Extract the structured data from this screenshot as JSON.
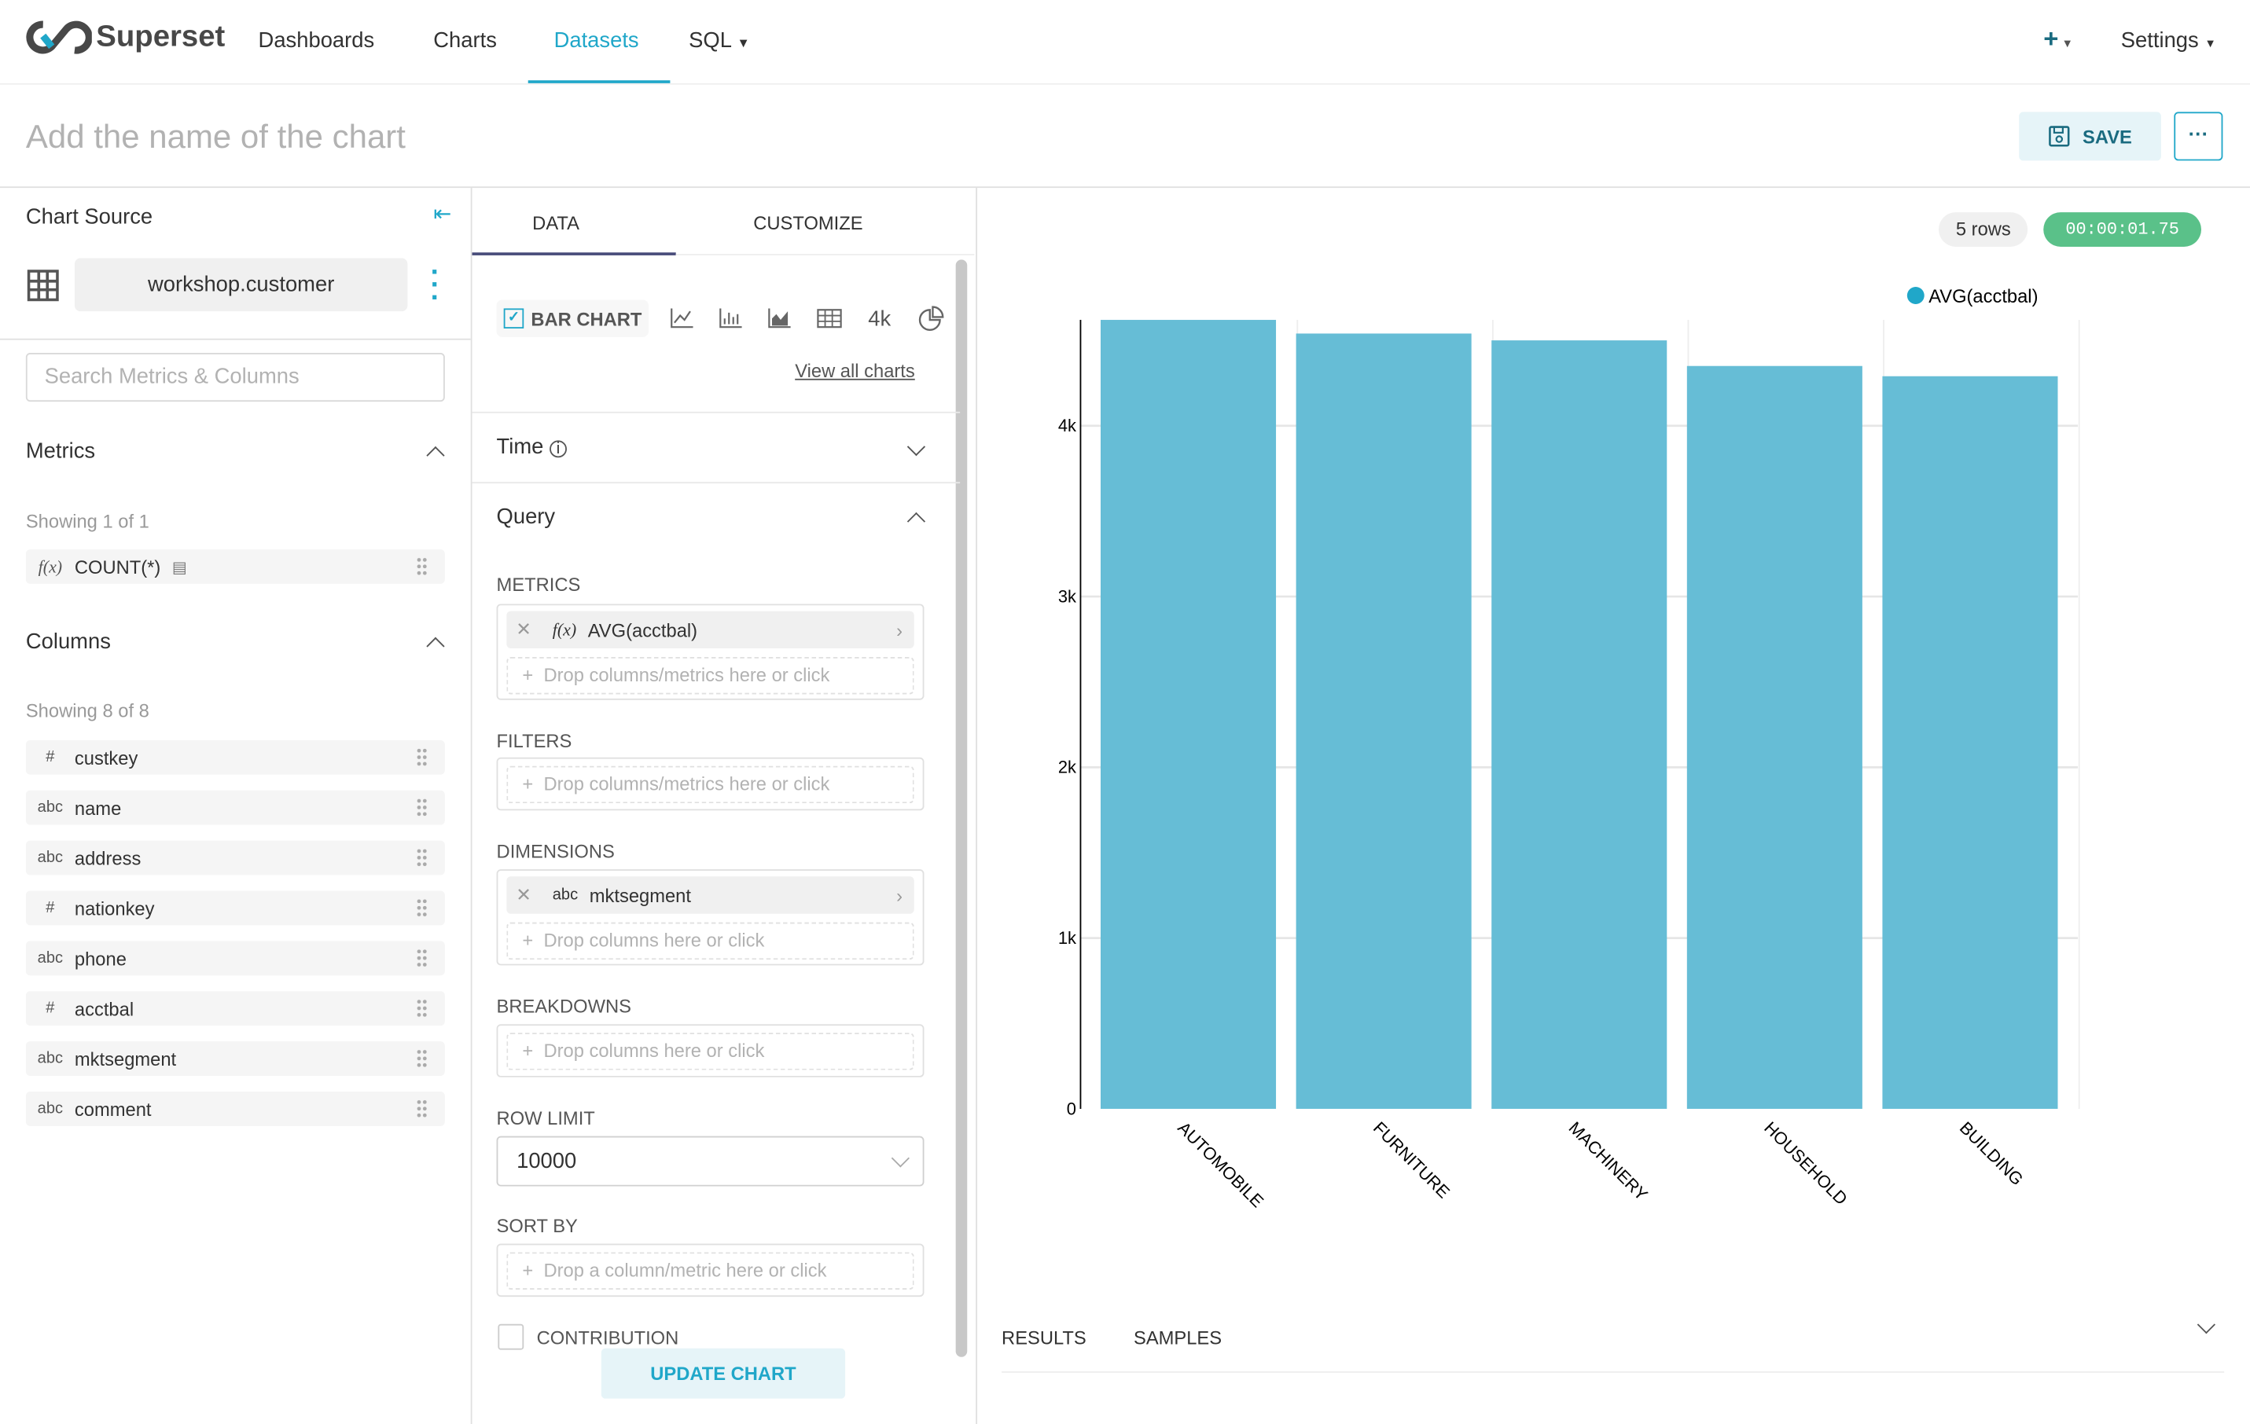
{
  "nav": {
    "brand": "Superset",
    "items": [
      "Dashboards",
      "Charts",
      "Datasets",
      "SQL"
    ],
    "active": "Datasets",
    "settings": "Settings",
    "plus": "+"
  },
  "header": {
    "title_placeholder": "Add the name of the chart",
    "save": "SAVE",
    "more": "···"
  },
  "left": {
    "chart_source": "Chart Source",
    "dataset": "workshop.customer",
    "search_placeholder": "Search Metrics & Columns",
    "metrics_title": "Metrics",
    "metrics_showing": "Showing 1 of 1",
    "metrics": [
      {
        "type": "f(x)",
        "name": "COUNT(*)"
      }
    ],
    "columns_title": "Columns",
    "columns_showing": "Showing 8 of 8",
    "columns": [
      {
        "type": "#",
        "name": "custkey"
      },
      {
        "type": "abc",
        "name": "name"
      },
      {
        "type": "abc",
        "name": "address"
      },
      {
        "type": "#",
        "name": "nationkey"
      },
      {
        "type": "abc",
        "name": "phone"
      },
      {
        "type": "#",
        "name": "acctbal"
      },
      {
        "type": "abc",
        "name": "mktsegment"
      },
      {
        "type": "abc",
        "name": "comment"
      }
    ]
  },
  "control": {
    "tabs": [
      "DATA",
      "CUSTOMIZE"
    ],
    "active_tab": "DATA",
    "viz": "BAR CHART",
    "bignum": "4k",
    "view_all": "View all charts",
    "time": "Time",
    "query": "Query",
    "metrics_label": "METRICS",
    "metric_chip": "AVG(acctbal)",
    "metric_fx": "f(x)",
    "drop_metrics": "Drop columns/metrics here or click",
    "filters_label": "FILTERS",
    "dimensions_label": "DIMENSIONS",
    "dim_type": "abc",
    "dim_chip": "mktsegment",
    "drop_columns": "Drop columns here or click",
    "breakdowns_label": "BREAKDOWNS",
    "row_limit_label": "ROW LIMIT",
    "row_limit": "10000",
    "sort_by_label": "SORT BY",
    "drop_sort": "Drop a column/metric here or click",
    "contribution": "CONTRIBUTION",
    "update": "UPDATE CHART"
  },
  "result": {
    "rows": "5 rows",
    "timer": "00:00:01.75",
    "tabs": [
      "RESULTS",
      "SAMPLES"
    ]
  },
  "colors": {
    "accent": "#20a7c9",
    "bar": "#66bdd6",
    "timer": "#5ac189"
  },
  "chart_data": {
    "type": "bar",
    "categories": [
      "AUTOMOBILE",
      "FURNITURE",
      "MACHINERY",
      "HOUSEHOLD",
      "BUILDING"
    ],
    "series": [
      {
        "name": "AVG(acctbal)",
        "values": [
          4620,
          4540,
          4500,
          4350,
          4290
        ]
      }
    ],
    "yticks": [
      "0",
      "1k",
      "2k",
      "3k",
      "4k"
    ],
    "ylim": [
      0,
      4620
    ],
    "legend": "top-right",
    "grid": true
  }
}
